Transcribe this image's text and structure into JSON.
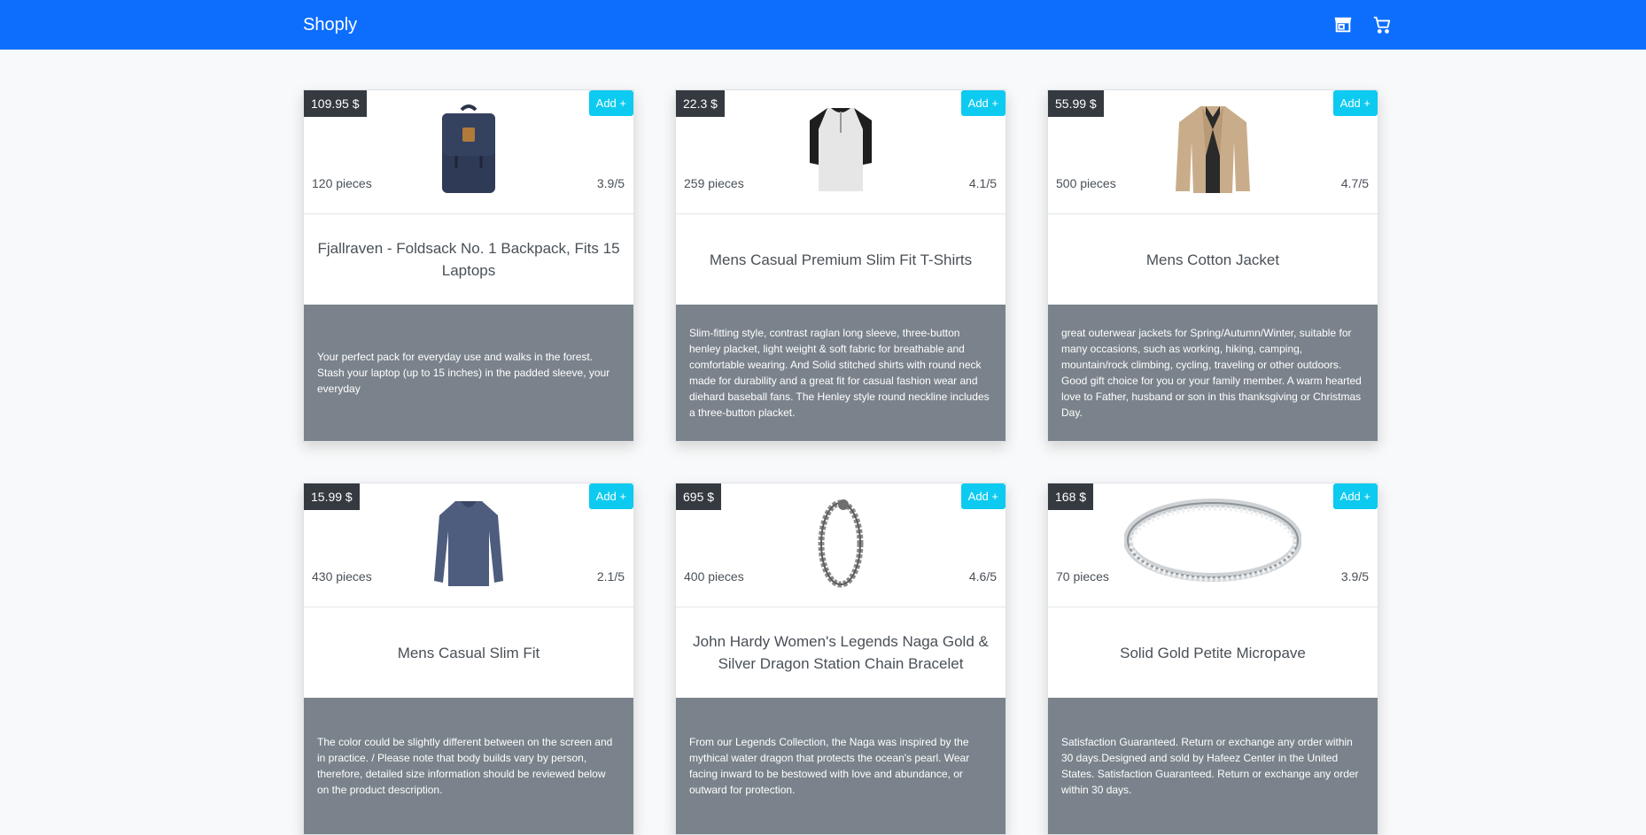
{
  "navbar": {
    "brand": "Shoply"
  },
  "products": [
    {
      "price": "109.95 $",
      "add": "Add +",
      "stock": "120 pieces",
      "rating": "3.9/5",
      "title": "Fjallraven - Foldsack No. 1 Backpack, Fits 15 Laptops",
      "description": "Your perfect pack for everyday use and walks in the forest. Stash your laptop (up to 15 inches) in the padded sleeve, your everyday"
    },
    {
      "price": "22.3 $",
      "add": "Add +",
      "stock": "259 pieces",
      "rating": "4.1/5",
      "title": "Mens Casual Premium Slim Fit T-Shirts",
      "description": "Slim-fitting style, contrast raglan long sleeve, three-button henley placket, light weight & soft fabric for breathable and comfortable wearing. And Solid stitched shirts with round neck made for durability and a great fit for casual fashion wear and diehard baseball fans. The Henley style round neckline includes a three-button placket."
    },
    {
      "price": "55.99 $",
      "add": "Add +",
      "stock": "500 pieces",
      "rating": "4.7/5",
      "title": "Mens Cotton Jacket",
      "description": "great outerwear jackets for Spring/Autumn/Winter, suitable for many occasions, such as working, hiking, camping, mountain/rock climbing, cycling, traveling or other outdoors. Good gift choice for you or your family member. A warm hearted love to Father, husband or son in this thanksgiving or Christmas Day."
    },
    {
      "price": "15.99 $",
      "add": "Add +",
      "stock": "430 pieces",
      "rating": "2.1/5",
      "title": "Mens Casual Slim Fit",
      "description": "The color could be slightly different between on the screen and in practice. / Please note that body builds vary by person, therefore, detailed size information should be reviewed below on the product description."
    },
    {
      "price": "695 $",
      "add": "Add +",
      "stock": "400 pieces",
      "rating": "4.6/5",
      "title": "John Hardy Women's Legends Naga Gold & Silver Dragon Station Chain Bracelet",
      "description": "From our Legends Collection, the Naga was inspired by the mythical water dragon that protects the ocean's pearl. Wear facing inward to be bestowed with love and abundance, or outward for protection."
    },
    {
      "price": "168 $",
      "add": "Add +",
      "stock": "70 pieces",
      "rating": "3.9/5",
      "title": "Solid Gold Petite Micropave",
      "description": "Satisfaction Guaranteed. Return or exchange any order within 30 days.Designed and sold by Hafeez Center in the United States. Satisfaction Guaranteed. Return or exchange any order within 30 days."
    }
  ]
}
